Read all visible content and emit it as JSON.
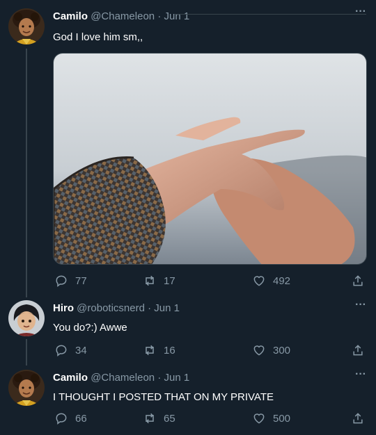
{
  "tweets": [
    {
      "name": "Camilo",
      "handle": "@Chameleon",
      "sep": "·",
      "date": "Jun 1",
      "text": "God I love him sm,,",
      "replies": "77",
      "retweets": "17",
      "likes": "492",
      "more": "···"
    },
    {
      "name": "Hiro",
      "handle": "@roboticsnerd",
      "sep": "·",
      "date": "Jun 1",
      "text": "You do?:) Awwe",
      "replies": "34",
      "retweets": "16",
      "likes": "300",
      "more": "···"
    },
    {
      "name": "Camilo",
      "handle": "@Chameleon",
      "sep": "·",
      "date": "Jun 1",
      "text": "I THOUGHT I POSTED THAT ON MY PRIVATE",
      "replies": "66",
      "retweets": "65",
      "likes": "500",
      "more": "···"
    }
  ],
  "icons": {
    "reply": "reply-icon",
    "retweet": "retweet-icon",
    "like": "heart-icon",
    "share": "share-icon",
    "more": "more-icon"
  },
  "colors": {
    "background": "#15202b",
    "muted": "#8899a6",
    "border": "#38444d"
  }
}
